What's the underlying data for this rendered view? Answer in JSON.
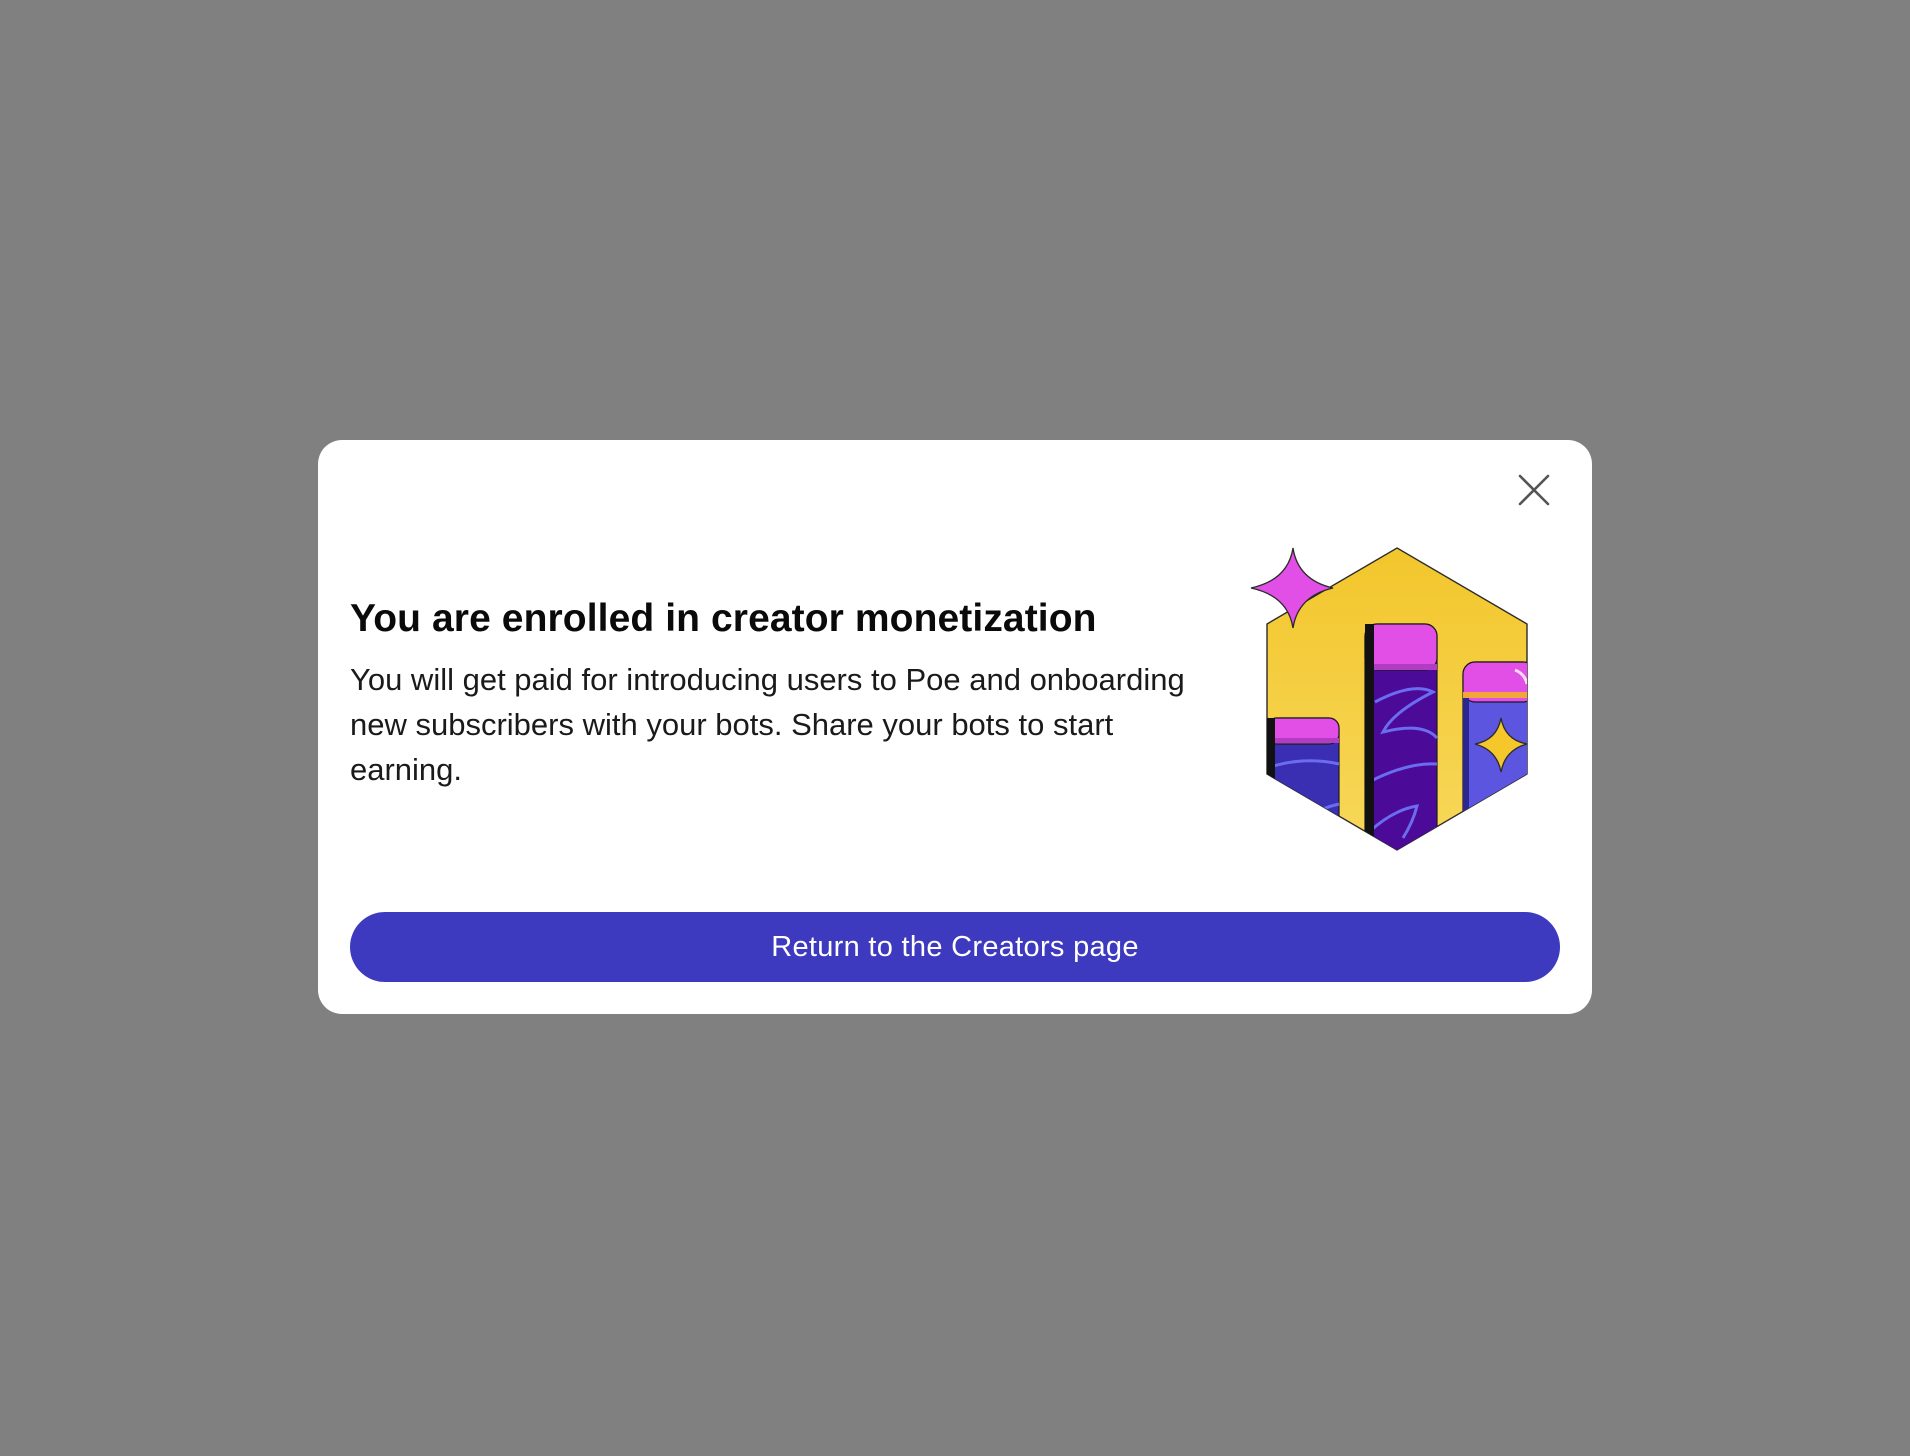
{
  "modal": {
    "title": "You are enrolled in creator monetization",
    "description": "You will get paid for introducing users to Poe and onboarding new subscribers with your bots. Share your bots to start earning.",
    "cta_label": "Return to the Creators page",
    "close_icon": "close-icon",
    "illustration_icon": "bar-chart-hexagon-illustration"
  },
  "colors": {
    "overlay": "#808080",
    "modal_bg": "#ffffff",
    "cta_bg": "#3d3abf",
    "cta_text": "#ffffff",
    "hex_yellow": "#f5c72a",
    "bar_purple": "#4a0a99",
    "bar_blue": "#5b55e0",
    "bar_magenta": "#e04fe8"
  }
}
